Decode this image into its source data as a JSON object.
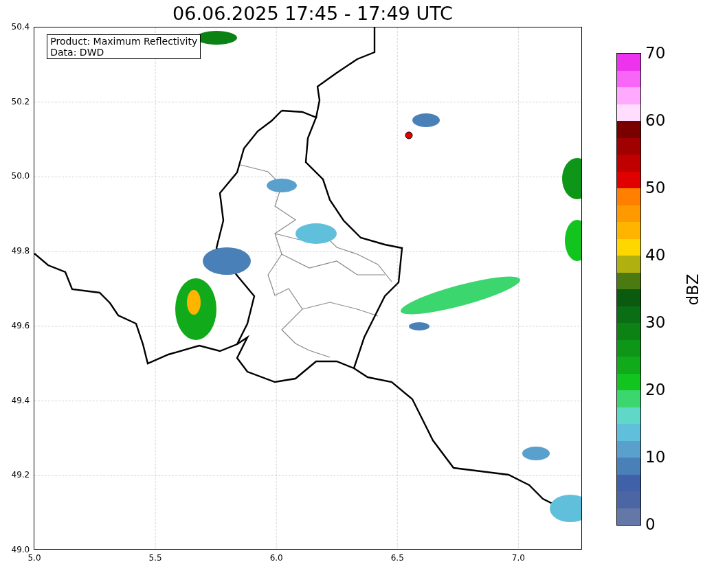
{
  "title": "06.06.2025 17:45 - 17:49 UTC",
  "info_box": [
    "Product: Maximum Reflectivity",
    "Data: DWD"
  ],
  "y_ticks": [
    "50.4",
    "50.2",
    "50.0",
    "49.8",
    "49.6",
    "49.4",
    "49.2",
    "49.0"
  ],
  "x_ticks": [
    "5.0",
    "5.5",
    "6.0",
    "6.5",
    "7.0"
  ],
  "colorbar": {
    "label": "dBZ",
    "ticks": [
      "70",
      "60",
      "50",
      "40",
      "30",
      "20",
      "10",
      "0"
    ],
    "segments": [
      {
        "color": "#ee33ee"
      },
      {
        "color": "#f866f8"
      },
      {
        "color": "#ffaaff"
      },
      {
        "color": "#ffddff"
      },
      {
        "color": "#7a0000"
      },
      {
        "color": "#a00000"
      },
      {
        "color": "#c00000"
      },
      {
        "color": "#e00000"
      },
      {
        "color": "#ff7f00"
      },
      {
        "color": "#ff9900"
      },
      {
        "color": "#ffb400"
      },
      {
        "color": "#ffd700"
      },
      {
        "color": "#b0b010"
      },
      {
        "color": "#4a7a10"
      },
      {
        "color": "#0a5a10"
      },
      {
        "color": "#0a6e14"
      },
      {
        "color": "#0c8214"
      },
      {
        "color": "#0e9618"
      },
      {
        "color": "#10aa1a"
      },
      {
        "color": "#12c41e"
      },
      {
        "color": "#3cd66e"
      },
      {
        "color": "#60d8c8"
      },
      {
        "color": "#60c0dc"
      },
      {
        "color": "#5aa0cc"
      },
      {
        "color": "#4a80b8"
      },
      {
        "color": "#4060a8"
      },
      {
        "color": "#4c66a4"
      },
      {
        "color": "#6478a8"
      }
    ]
  }
}
